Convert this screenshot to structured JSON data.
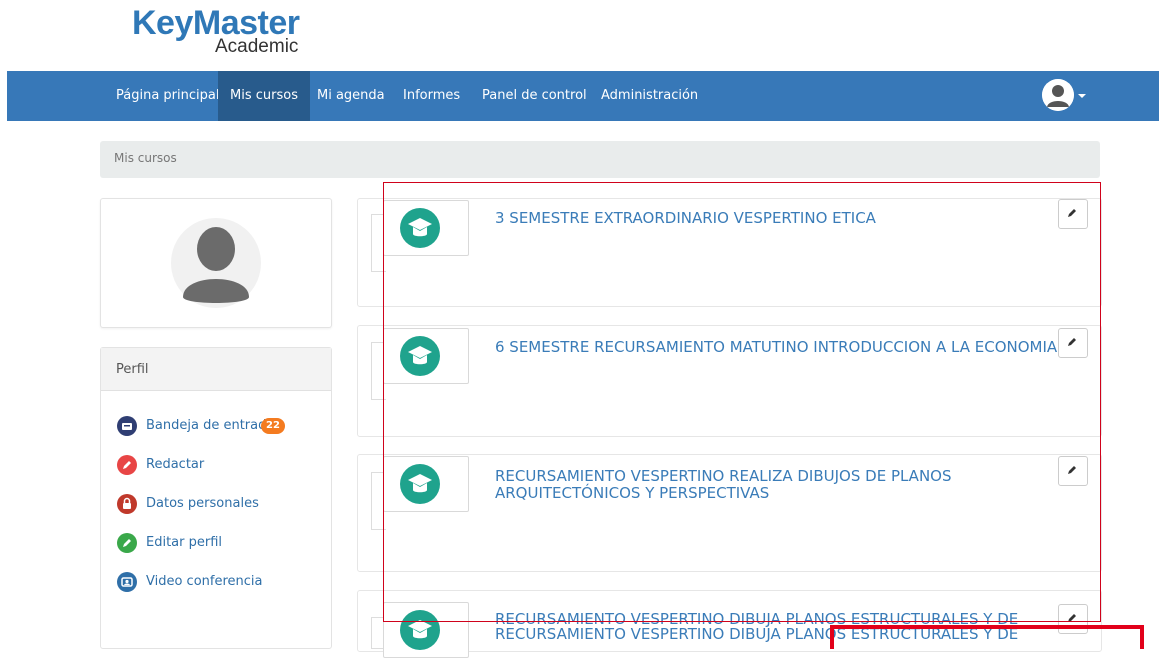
{
  "logo": {
    "brand": "KeyMaster",
    "sub": "Academic"
  },
  "nav": {
    "items": [
      "Página principal",
      "Mis cursos",
      "Mi agenda",
      "Informes",
      "Panel de control",
      "Administración"
    ],
    "active": "Mis cursos"
  },
  "breadcrumb": "Mis cursos",
  "perfil": {
    "title": "Perfil",
    "items": [
      {
        "label": "Bandeja de entrada",
        "icon": "inbox-icon",
        "color": "#2f3e73",
        "badge": "22"
      },
      {
        "label": "Redactar",
        "icon": "pencil-icon",
        "color": "#e84545"
      },
      {
        "label": "Datos personales",
        "icon": "lock-icon",
        "color": "#c0392b"
      },
      {
        "label": "Editar perfil",
        "icon": "edit-icon",
        "color": "#3aa84a"
      },
      {
        "label": "Video conferencia",
        "icon": "video-icon",
        "color": "#2f6fa8"
      }
    ]
  },
  "courses": [
    {
      "title": "3 SEMESTRE EXTRAORDINARIO VESPERTINO ETICA"
    },
    {
      "title": "6 SEMESTRE RECURSAMIENTO MATUTINO INTRODUCCION A LA ECONOMIA"
    },
    {
      "title_lines": [
        "RECURSAMIENTO VESPERTINO REALIZA DIBUJOS DE PLANOS",
        "ARQUITECTÓNICOS Y PERSPECTIVAS"
      ]
    },
    {
      "title_lines": [
        "RECURSAMIENTO VESPERTINO DIBUJA PLANOS ESTRUCTURALES Y DE",
        "RECURSAMIENTO VESPERTINO DIBUJA PLANOS ESTRUCTURALES Y DE"
      ]
    }
  ],
  "colors": {
    "navbar": "#3778b8",
    "active_tab": "#285b8c",
    "link": "#3a7cb8",
    "course_icon": "#1fa38d",
    "badge": "#f47b20",
    "highlight": "#d0021b"
  }
}
